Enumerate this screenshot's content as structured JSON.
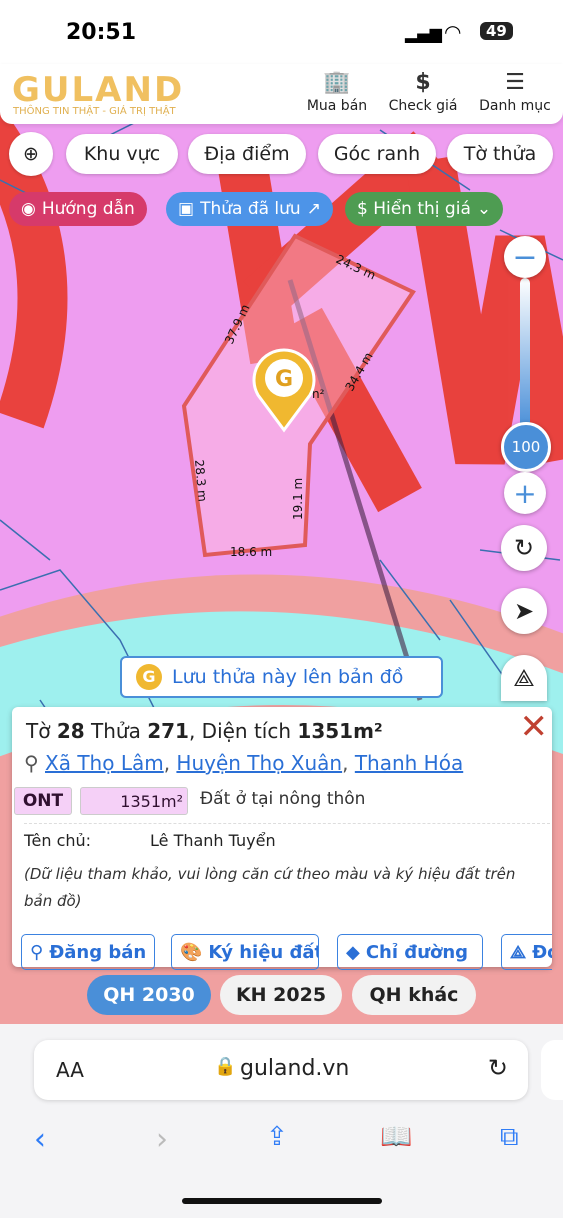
{
  "status": {
    "time": "20:51",
    "battery": "49"
  },
  "header": {
    "logo": "GULAND",
    "slogan": "THÔNG TIN THẬT - GIÁ TRỊ THẬT",
    "nav": [
      {
        "label": "Mua bán",
        "icon": "building-icon"
      },
      {
        "label": "Check giá",
        "icon": "dollar-icon"
      },
      {
        "label": "Danh mục",
        "icon": "menu-icon"
      }
    ]
  },
  "filters": [
    "Khu vực",
    "Địa điểm",
    "Góc ranh",
    "Tờ thửa"
  ],
  "chips": {
    "guide": "Hướng dẫn",
    "saved": "Thửa đã lưu",
    "price": "$ Hiển thị giá"
  },
  "map": {
    "zoom": "100",
    "edges": [
      "24.3 m",
      "34.4 m",
      "19.1 m",
      "18.6 m",
      "28.3 m",
      "37.9 m"
    ],
    "area_fragment": "n²",
    "save_banner": "Lưu thửa này lên bản đồ"
  },
  "card": {
    "to_label": "Tờ",
    "to": "28",
    "thua_label": "Thửa",
    "thua": "271",
    "dt_label": ", Diện tích",
    "area": "1351m²",
    "commune": "Xã Thọ Lâm",
    "district": "Huyện Thọ Xuân",
    "province": "Thanh Hóa",
    "land_code": "ONT",
    "land_area": "1351m²",
    "land_type": "Đất ở tại nông thôn",
    "owner_label": "Tên chủ:",
    "owner": "Lê Thanh Tuyển",
    "note": "(Dữ liệu tham khảo, vui lòng căn cứ theo màu và ký hiệu đất trên bản đồ)",
    "actions": [
      "Đăng bán",
      "Ký hiệu đất",
      "Chỉ đường",
      "Đo"
    ]
  },
  "layers": [
    "QH 2030",
    "KH 2025",
    "QH khác"
  ],
  "browser": {
    "aa": "AA",
    "url": "guland.vn"
  },
  "colors": {
    "accent": "#4a8fd8",
    "guide": "#d63a6a",
    "saved": "#4d94e8",
    "price": "#4e9c52",
    "land_ont": "#f5d0f7"
  }
}
